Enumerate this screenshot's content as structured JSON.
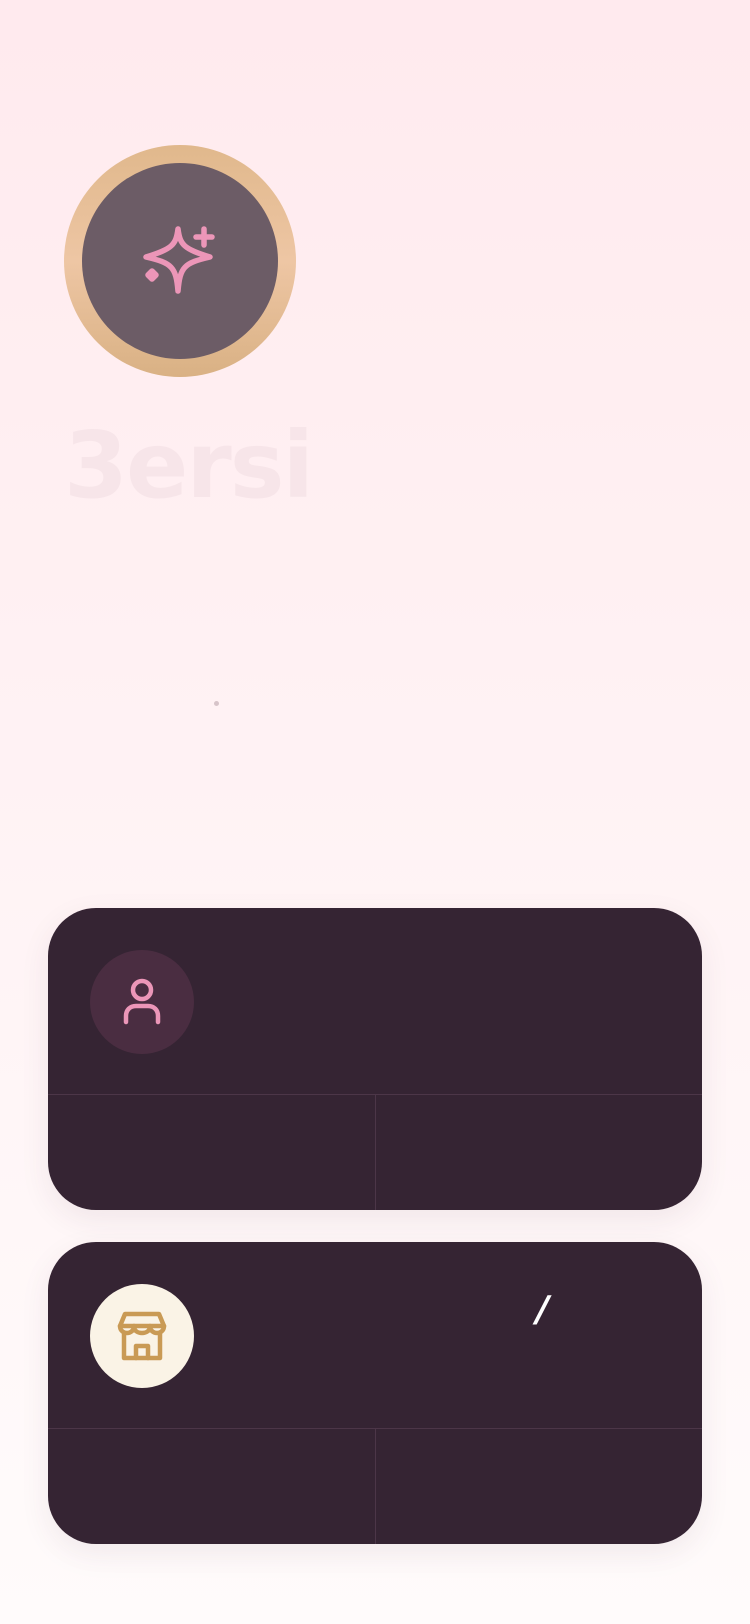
{
  "app": {
    "brand_name": "3ersi"
  },
  "colors": {
    "background_top": "#ffeaee",
    "logo_ring": "#e0b88c",
    "logo_inner": "#6c5c66",
    "accent_pink": "#ec96b8",
    "accent_gold": "#c99a55",
    "card_bg": "#352433"
  },
  "logo": {
    "icon": "sparkles-icon"
  },
  "cards": [
    {
      "id": "customer",
      "icon": "user-icon",
      "icon_bg": "#4a2d41",
      "icon_color": "#ec96b8"
    },
    {
      "id": "merchant",
      "icon": "store-icon",
      "icon_bg": "#faf3e6",
      "icon_color": "#c99a55",
      "title_fragment": "/"
    }
  ]
}
